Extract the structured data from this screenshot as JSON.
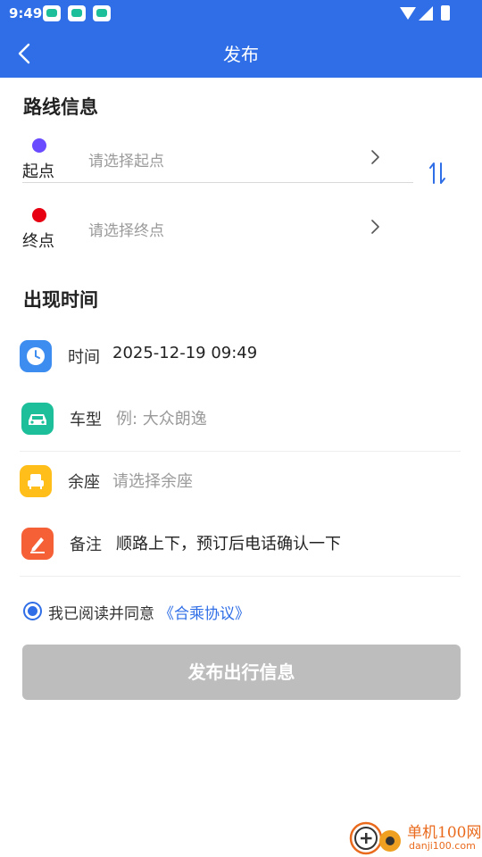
{
  "status_bar": {
    "time": "9:49",
    "notification_icons": [
      "car-app-icon",
      "car-app-icon",
      "car-app-icon"
    ],
    "system_icons": [
      "wifi-icon",
      "signal-icon",
      "battery-icon"
    ]
  },
  "header": {
    "title": "发布",
    "back_icon": "chevron-left-icon",
    "background_color": "#2f6ee6"
  },
  "route_section": {
    "title": "路线信息",
    "start": {
      "label": "起点",
      "placeholder": "请选择起点",
      "dot_color": "#6a4bff"
    },
    "end": {
      "label": "终点",
      "placeholder": "请选择终点",
      "dot_color": "#e60012"
    },
    "swap_icon": "swap-vertical-icon"
  },
  "time_section": {
    "title": "出现时间",
    "rows": [
      {
        "icon": "clock-icon",
        "icon_color": "#3d8cf0",
        "label": "时间",
        "value": "2025-12-19 09:49",
        "is_placeholder": false
      },
      {
        "icon": "car-icon",
        "icon_color": "#1cbf9a",
        "label": "车型",
        "value": "例: 大众朗逸",
        "is_placeholder": true
      },
      {
        "icon": "seat-icon",
        "icon_color": "#ffbe1a",
        "label": "余座",
        "value": "请选择余座",
        "is_placeholder": true
      },
      {
        "icon": "edit-icon",
        "icon_color": "#f56036",
        "label": "备注",
        "value": "顺路上下，预订后电话确认一下",
        "is_placeholder": false
      }
    ]
  },
  "agreement": {
    "checked": true,
    "text": "我已阅读并同意",
    "link": "《合乘协议》"
  },
  "submit_button": {
    "label": "发布出行信息",
    "enabled": false
  },
  "watermark": {
    "name": "单机100网",
    "url": "danji100.com"
  }
}
